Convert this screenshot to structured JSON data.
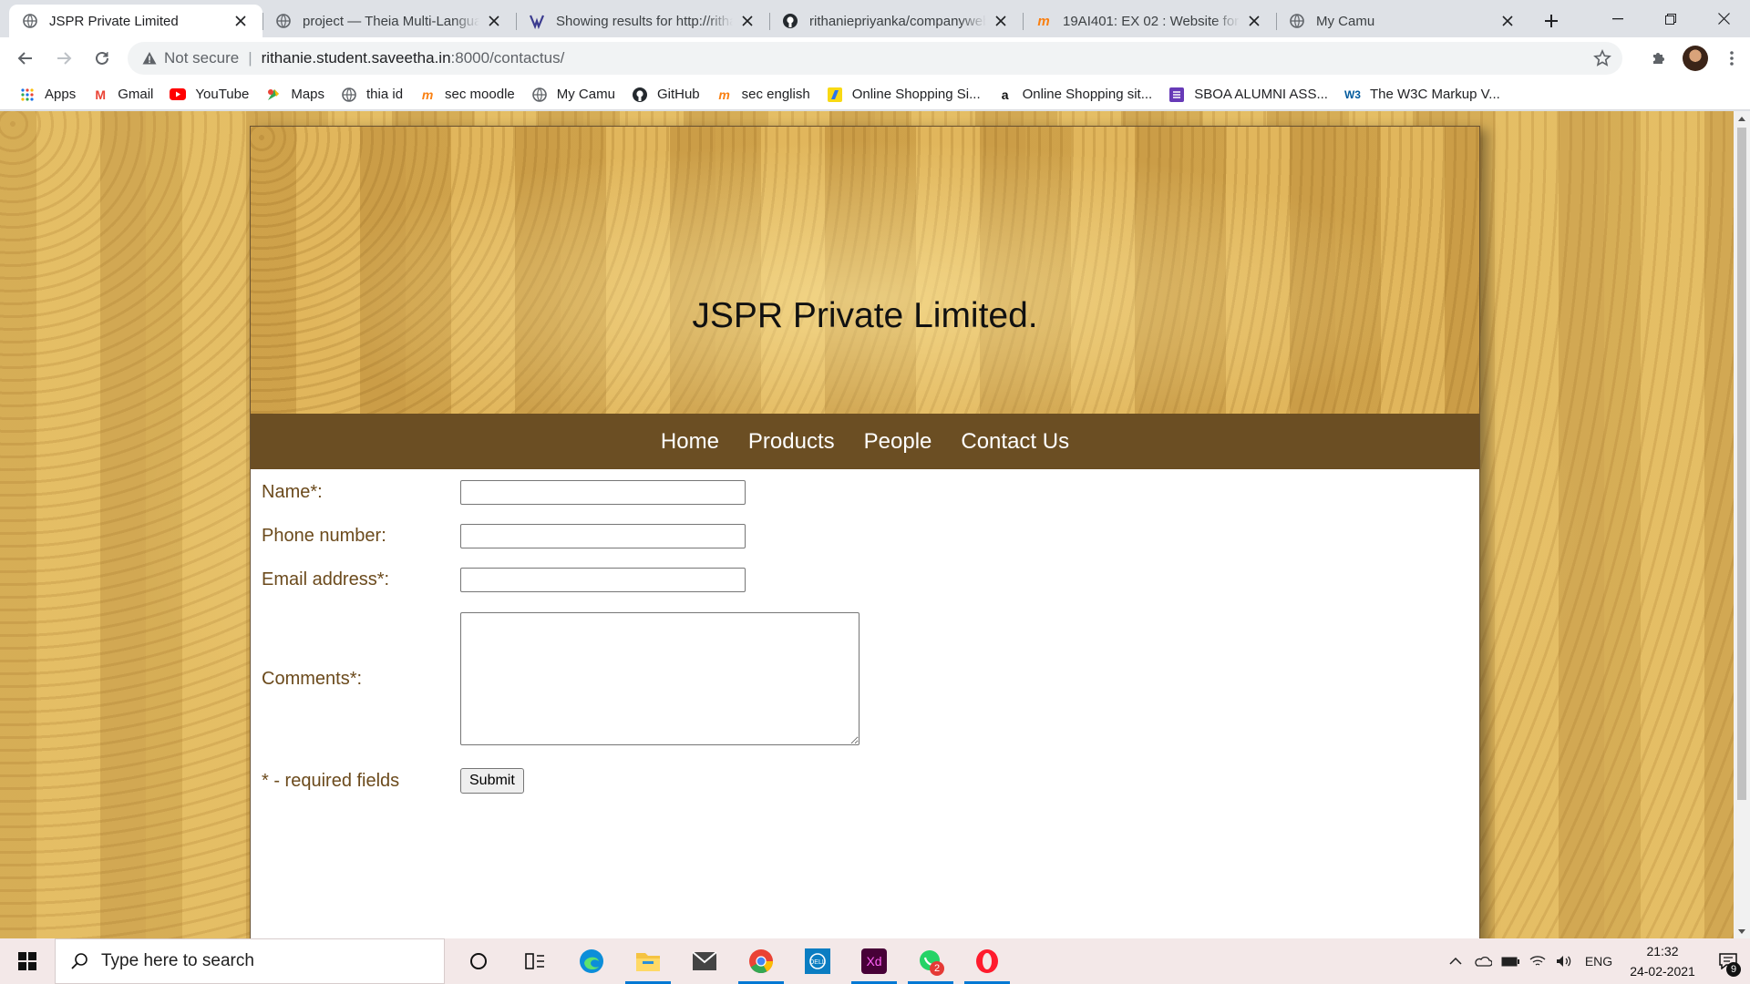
{
  "browser": {
    "tabs": [
      {
        "title": "JSPR Private Limited",
        "icon": "globe-icon",
        "active": true
      },
      {
        "title": "project — Theia Multi-Language",
        "icon": "globe-icon",
        "active": false
      },
      {
        "title": "Showing results for http://rithanie",
        "icon": "search-results-icon",
        "active": false
      },
      {
        "title": "rithaniepriyanka/companywebsite",
        "icon": "github-icon",
        "active": false
      },
      {
        "title": "19AI401: EX 02 : Website for",
        "icon": "moodle-icon",
        "active": false
      },
      {
        "title": "My Camu",
        "icon": "globe-icon",
        "active": false
      }
    ],
    "address": {
      "security_label": "Not secure",
      "url_host": "rithanie.student.saveetha.in",
      "url_rest": ":8000/contactus/"
    },
    "bookmarks": [
      {
        "label": "Apps",
        "icon": "apps-grid-icon"
      },
      {
        "label": "Gmail",
        "icon": "gmail-icon"
      },
      {
        "label": "YouTube",
        "icon": "youtube-icon"
      },
      {
        "label": "Maps",
        "icon": "maps-icon"
      },
      {
        "label": "thia id",
        "icon": "globe-icon"
      },
      {
        "label": "sec moodle",
        "icon": "moodle-icon"
      },
      {
        "label": "My Camu",
        "icon": "globe-icon"
      },
      {
        "label": "GitHub",
        "icon": "github-icon"
      },
      {
        "label": "sec english",
        "icon": "moodle-icon"
      },
      {
        "label": "Online Shopping Si...",
        "icon": "flipkart-icon"
      },
      {
        "label": "Online Shopping sit...",
        "icon": "amazon-icon"
      },
      {
        "label": "SBOA ALUMNI ASS...",
        "icon": "forms-icon"
      },
      {
        "label": "The W3C Markup V...",
        "icon": "w3c-icon"
      }
    ]
  },
  "page": {
    "site_title": "JSPR Private Limited.",
    "nav": [
      "Home",
      "Products",
      "People",
      "Contact Us"
    ],
    "form": {
      "name_label": "Name*:",
      "phone_label": "Phone number:",
      "email_label": "Email address*:",
      "comments_label": "Comments*:",
      "required_note": "* - required fields",
      "submit_label": "Submit"
    }
  },
  "taskbar": {
    "search_placeholder": "Type here to search",
    "apps": [
      "cortana-icon",
      "task-view-icon",
      "edge-icon",
      "file-explorer-icon",
      "mail-icon",
      "chrome-icon",
      "dell-icon",
      "adobe-xd-icon",
      "whatsapp-icon",
      "opera-icon"
    ],
    "whatsapp_badge": "2",
    "language": "ENG",
    "time": "21:32",
    "date": "24-02-2021",
    "notification_count": "9"
  },
  "colors": {
    "nav_bar": "#6b4e23",
    "label_text": "#6b4a1c",
    "page_background": "#e1b85e"
  }
}
